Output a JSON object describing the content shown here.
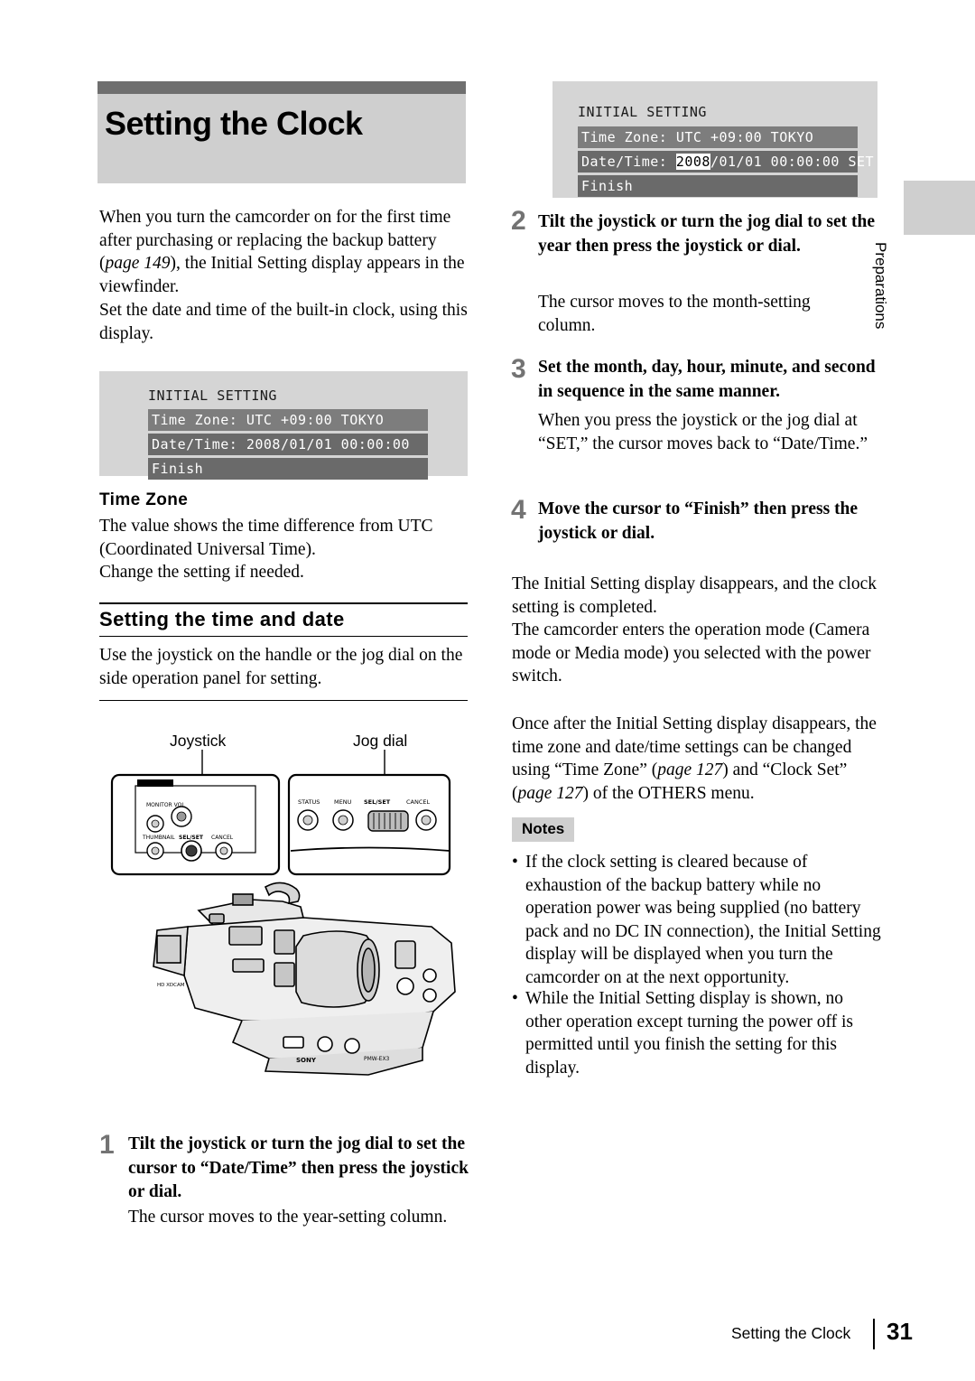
{
  "page": {
    "title": "Setting the Clock",
    "footer_title": "Setting the Clock",
    "page_number": "31",
    "side_tab_label": "Preparations"
  },
  "left_column": {
    "intro_paragraph_1": "When you turn the camcorder on for the first time after purchasing or replacing the backup battery (page 149), the Initial Setting display appears in the viewfinder.",
    "intro_paragraph_1_italic": "page 149",
    "intro_paragraph_2": "Set the date and time of the built-in clock, using this display.",
    "lcd_left": {
      "header": "INITIAL SETTING",
      "row_1": "Time Zone: UTC +09:00 TOKYO",
      "row_2": "Date/Time: 2008/01/01 00:00:00",
      "row_3": "Finish"
    },
    "time_zone_heading": "Time Zone",
    "time_zone_body": "The value shows the time difference from UTC (Coordinated Universal Time).\nChange the setting if needed.",
    "setting_time_heading": "Setting the time and date",
    "setting_time_body": "Use the joystick on the handle or the jog dial on the side operation panel for setting.",
    "illustration": {
      "label_joystick": "Joystick",
      "label_jog_dial": "Jog dial",
      "panel_left_labels": [
        "MONITOR VOL",
        "THUMBNAIL",
        "SEL/SET",
        "CANCEL"
      ],
      "panel_right_labels": [
        "STATUS",
        "MENU",
        "SEL/SET",
        "CANCEL"
      ],
      "camcorder_brand": "SONY",
      "camcorder_text_1": "HD XDCAM",
      "camcorder_text_2": "PMW-EX3"
    },
    "step_1": {
      "number": "1",
      "heading": "Tilt the joystick or turn the jog dial to set the cursor to “Date/Time” then press the joystick or dial.",
      "body": "The cursor moves to the year-setting column."
    }
  },
  "right_column": {
    "lcd_right": {
      "header": "INITIAL SETTING",
      "row_1": "Time Zone: UTC +09:00 TOKYO",
      "row_2_prefix": "Date/Time: ",
      "row_2_cursor": "2008",
      "row_2_suffix": "/01/01 00:00:00 SET",
      "row_3": "Finish"
    },
    "step_2": {
      "number": "2",
      "heading": "Tilt the joystick or turn the jog dial to set the year then press the joystick or dial.",
      "body": "The cursor moves to the month-setting column."
    },
    "step_3": {
      "number": "3",
      "heading": "Set the month, day, hour, minute, and second in sequence in the same manner.",
      "body": "When you press the joystick or the jog dial at “SET,” the cursor moves back to “Date/Time.”"
    },
    "step_4": {
      "number": "4",
      "heading": "Move the cursor to “Finish” then press the joystick or dial."
    },
    "paragraph_1": "The Initial Setting display disappears, and the clock setting is completed.\nThe camcorder enters the operation mode (Camera mode or Media mode) you selected with the power switch.",
    "paragraph_2": "Once after the Initial Setting display disappears, the time zone and date/time settings can be changed using “Time Zone” (page 127) and “Clock Set” (page 127) of the OTHERS menu.",
    "notes_label": "Notes",
    "note_1": "If the clock setting is cleared because of exhaustion of the backup battery while no operation power was being supplied (no battery pack and no DC IN connection), the Initial Setting display will be displayed when you turn the camcorder on at the next opportunity.",
    "note_2": "While the Initial Setting display is shown, no other operation except turning the power off is permitted until you finish the setting for this display.",
    "bullet": "•"
  },
  "colors": {
    "title_bar": "#6f6f6f",
    "title_bg": "#cfcfcf",
    "lcd_bg": "#d5d5d5",
    "lcd_row": "#7d7d7d",
    "step_number": "#737373"
  }
}
